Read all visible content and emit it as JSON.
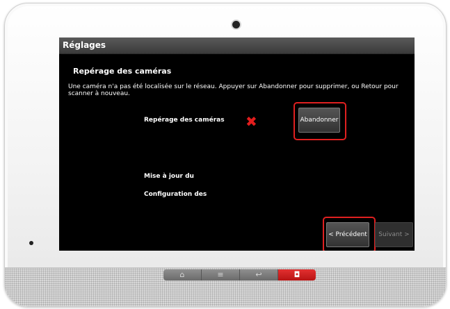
{
  "screen": {
    "title": "Réglages",
    "heading": "Repérage des caméras",
    "message": "Une caméra n'a pas été localisée sur le réseau. Appuyer sur Abandonner pour supprimer, ou Retour pour scanner à nouveau.",
    "steps": [
      {
        "label": "Repérage des caméras",
        "status": "✖"
      },
      {
        "label": "Mise à jour du"
      },
      {
        "label": "Configuration des"
      }
    ],
    "abort_button": "Abandonner",
    "prev_button": "< Précédent",
    "next_button": "Suivant >"
  },
  "hardware_buttons": [
    {
      "icon": "home-icon",
      "glyph": "⌂"
    },
    {
      "icon": "menu-icon",
      "glyph": "≡"
    },
    {
      "icon": "back-icon",
      "glyph": "↩"
    },
    {
      "icon": "alarm-icon",
      "glyph": "◘"
    }
  ],
  "colors": {
    "highlight": "#e02020",
    "status_fail": "#e21d1d",
    "screen_bg": "#000000"
  }
}
